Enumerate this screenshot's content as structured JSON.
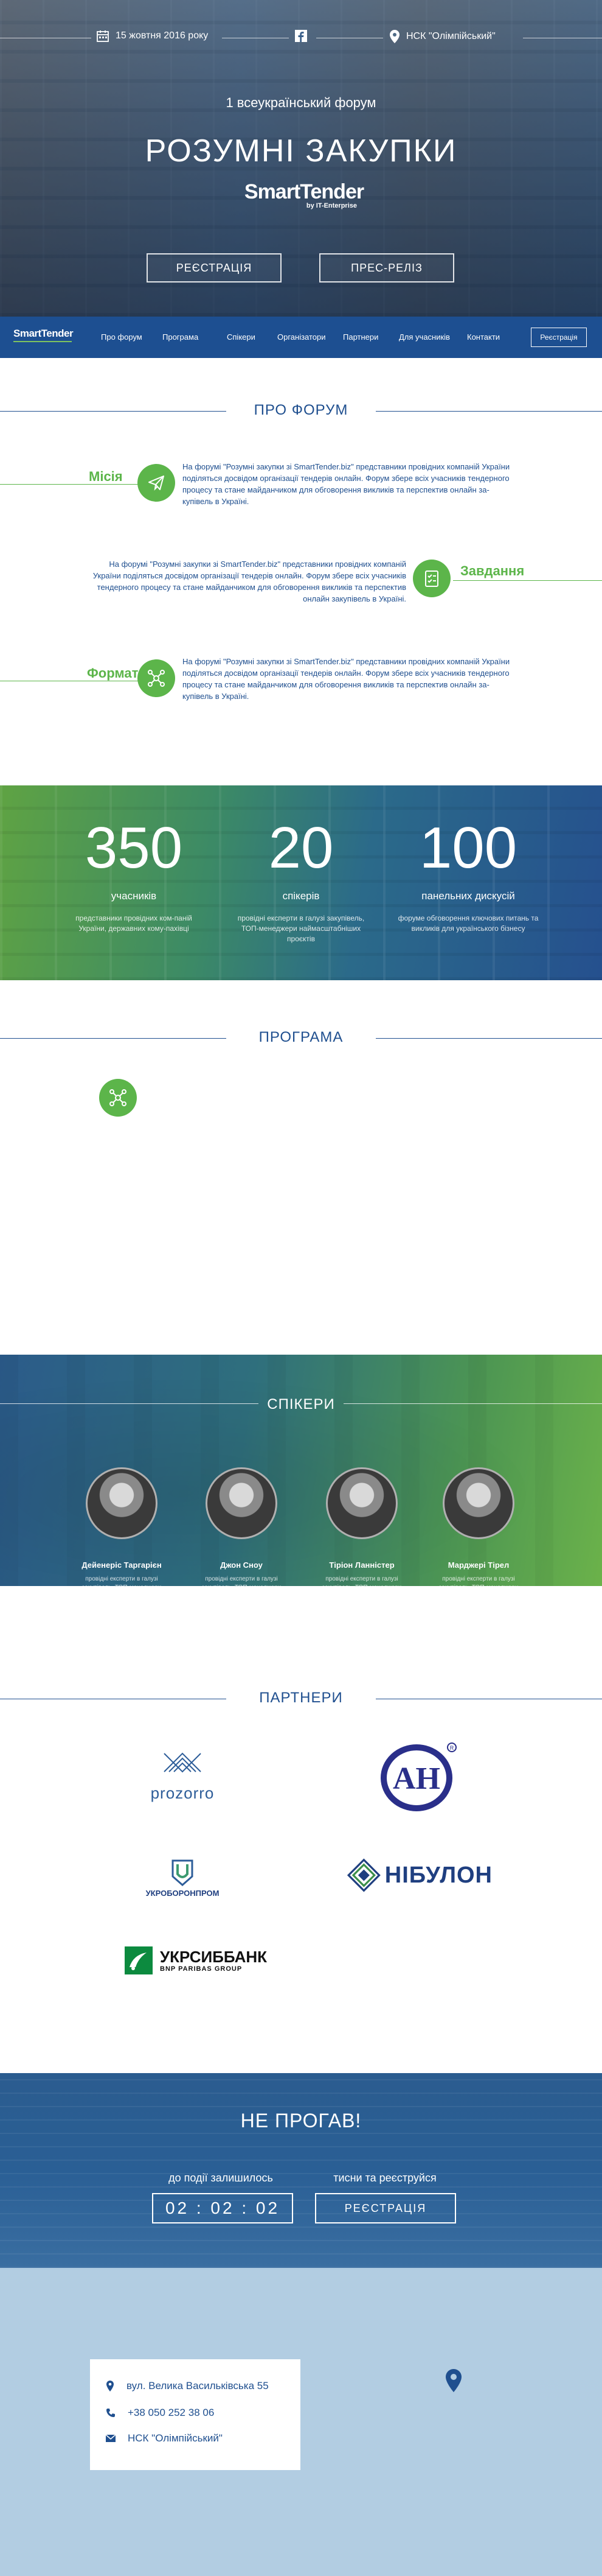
{
  "hero": {
    "date": "15 жовтня 2016 року",
    "venue": "НСК \"Олімпійський\"",
    "subtitle": "1 всеукраїнський форум",
    "title": "РОЗУМНІ ЗАКУПКИ",
    "logo_text": "SmartTender",
    "logo_tagline": "by IT-Enterprise",
    "btn_register": "РЕЄСТРАЦІЯ",
    "btn_press": "ПРЕС-РЕЛІЗ"
  },
  "nav": {
    "logo_text": "SmartTender",
    "items": [
      "Про форум",
      "Програма",
      "Спікери",
      "Організатори",
      "Партнери",
      "Для учасників",
      "Контакти"
    ],
    "register": "Реєстрація"
  },
  "about": {
    "title": "ПРО ФОРУМ",
    "blocks": [
      {
        "label": "Місія",
        "icon": "paper-plane-icon",
        "text": "На форумі \"Розумні закупки зі SmartTender.biz\" представники провідних компаній України поділяться досвідом організації тендерів онлайн. Форум збере всіх учасників тендерного процесу та стане майданчиком для обговорення викликів та перспектив онлайн за-купівель в Україні."
      },
      {
        "label": "Завдання",
        "icon": "checklist-icon",
        "text": "На форумі \"Розумні закупки зі SmartTender.biz\" представники провідних компаній України поділяться досвідом організації тендерів онлайн. Форум збере всіх учасників тендерного процесу та стане майданчиком для обговорення викликів та перспектив онлайн закупівель в Україні."
      },
      {
        "label": "Формат",
        "icon": "network-icon",
        "text": "На форумі \"Розумні закупки зі SmartTender.biz\" представники провідних компаній України поділяться досвідом організації тендерів онлайн. Форум збере всіх учасників тендерного процесу та стане майданчиком для обговорення викликів та перспектив онлайн за-купівель в Україні."
      }
    ]
  },
  "stats": [
    {
      "num": "350",
      "label": "учасників",
      "desc": "представники провідних ком-паній України, державних кому-пахівці"
    },
    {
      "num": "20",
      "label": "спікерів",
      "desc": "провідні експерти в галузі закупівель, ТОП-менеджери наймасштабніших проєктів"
    },
    {
      "num": "100",
      "label": "панельних дискусій",
      "desc": "форуме обговорення ключових питань та викликів для українського бізнесу"
    }
  ],
  "program": {
    "title": "ПРОГРАМА",
    "icon": "network-icon"
  },
  "speakers": {
    "title": "СПІКЕРИ",
    "items": [
      {
        "name": "Дейенеріс Таргарієн",
        "desc": "провідні експерти в галузі закупівель, ТОП-менеджери наймасштабніших проєктів з'явився у Харкові"
      },
      {
        "name": "Джон Сноу",
        "desc": "провідні експерти в галузі закупівель, ТОП-менеджери наймасштабніших проєктів з'явився у Харкові"
      },
      {
        "name": "Тіріон Ланністер",
        "desc": "провідні експерти в галузі закупівель, ТОП-менеджери наймасштабніших проєктів з'явився у Харкові"
      },
      {
        "name": "Марджері Тірел",
        "desc": "провідні експерти в галузі закупівель, ТОП-менеджери наймасштабніших проєктів з'явився у Харкові"
      }
    ]
  },
  "partners": {
    "title": "ПАРТНЕРИ",
    "prozorro": "prozorro",
    "antonov": "АН",
    "ukroboronprom": "УКРОБОРОНПРОМ",
    "nibulon": "НІБУЛОН",
    "ukrsib_main": "УКРСИББАНК",
    "ukrsib_sub": "BNP PARIBAS GROUP"
  },
  "countdown": {
    "title": "НЕ ПРОГАВ!",
    "label_left": "до події залишилось",
    "timer": "02 : 02 : 02",
    "label_right": "тисни та реєструйся",
    "register": "РЕЄСТРАЦІЯ"
  },
  "contact": {
    "address": "вул. Велика Васильківська 55",
    "phone": "+38 050 252 38 06",
    "venue": "НСК \"Олімпійський\""
  }
}
